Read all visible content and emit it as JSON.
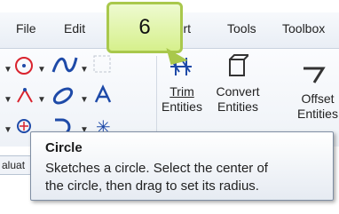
{
  "menu": {
    "items": [
      "File",
      "Edit",
      "Insert",
      "Tools",
      "Toolbox"
    ]
  },
  "callout": {
    "number": "6"
  },
  "ribbon": {
    "trim": {
      "line1": "Trim",
      "line2": "Entities"
    },
    "convert": {
      "line1": "Convert",
      "line2": "Entities"
    },
    "offset": {
      "line1": "Offset",
      "line2": "Entities"
    }
  },
  "evaluate_tab": {
    "label": "aluat"
  },
  "tooltip": {
    "title": "Circle",
    "line1": "Sketches a circle. Select the center of",
    "line2": "the circle, then drag to set its radius."
  },
  "colors": {
    "accent_red": "#d9232e",
    "icon_blue": "#1e4aa8",
    "callout_green": "#d6f08c"
  }
}
